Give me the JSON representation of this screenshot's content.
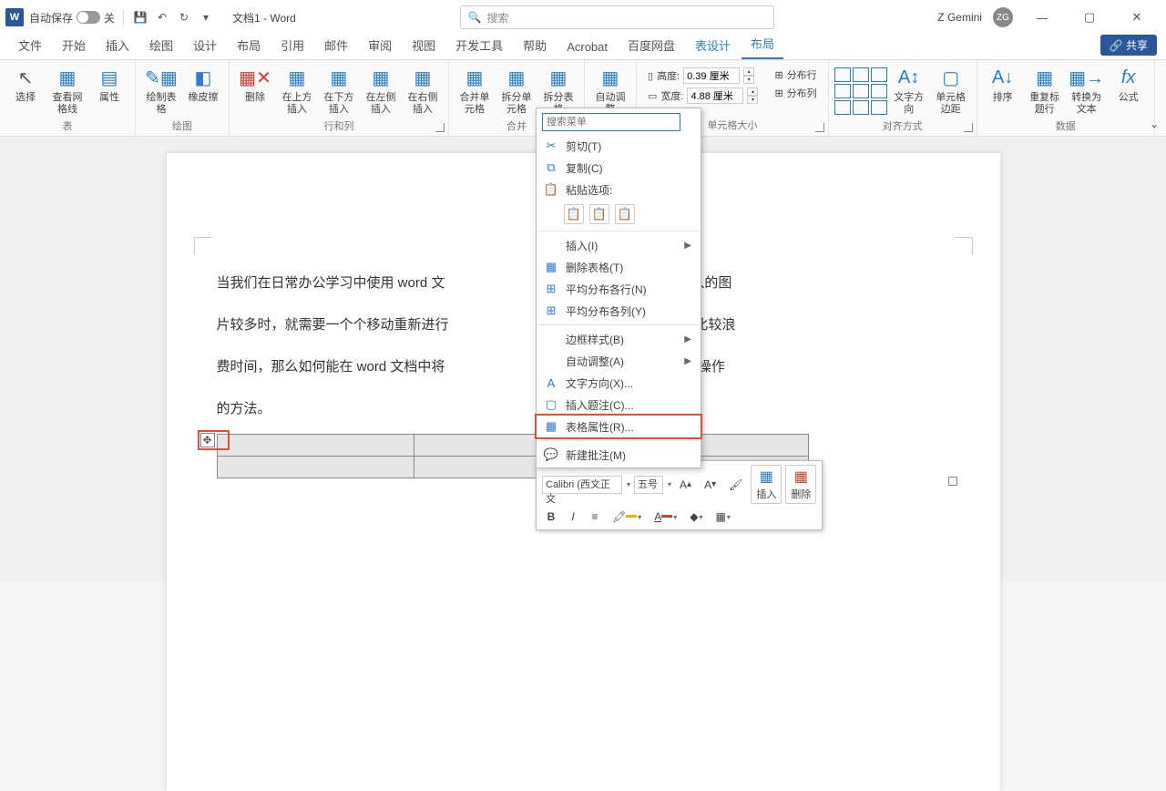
{
  "titlebar": {
    "autosave_label": "自动保存",
    "autosave_state": "关",
    "doc_title": "文档1 - Word",
    "search_placeholder": "搜索",
    "user_name": "Z Gemini",
    "user_initials": "ZG"
  },
  "tabs": [
    "文件",
    "开始",
    "插入",
    "绘图",
    "设计",
    "布局",
    "引用",
    "邮件",
    "审阅",
    "视图",
    "开发工具",
    "帮助",
    "Acrobat",
    "百度网盘",
    "表设计",
    "布局"
  ],
  "active_tab_index": 15,
  "context_tab_indices": [
    14,
    15
  ],
  "share_label": "共享",
  "ribbon": {
    "group_table": {
      "label": "表",
      "cmds": [
        "选择",
        "查看网格线",
        "属性"
      ]
    },
    "group_draw": {
      "label": "绘图",
      "cmds": [
        "绘制表格",
        "橡皮擦"
      ]
    },
    "group_rowscols": {
      "label": "行和列",
      "cmds": [
        "删除",
        "在上方插入",
        "在下方插入",
        "在左侧插入",
        "在右侧插入"
      ]
    },
    "group_merge": {
      "label": "合并",
      "cmds": [
        "合并单元格",
        "拆分单元格",
        "拆分表格"
      ]
    },
    "group_autofit": "自动调整",
    "group_cellsize": {
      "label": "单元格大小",
      "height_label": "高度:",
      "width_label": "宽度:",
      "height_value": "0.39 厘米",
      "width_value": "4.88 厘米",
      "dist_rows": "分布行",
      "dist_cols": "分布列"
    },
    "group_align": {
      "label": "对齐方式",
      "text_dir": "文字方向",
      "cell_margin": "单元格边距"
    },
    "group_data": {
      "label": "数据",
      "cmds": [
        "排序",
        "重复标题行",
        "转换为文本",
        "公式"
      ]
    }
  },
  "document": {
    "body_lines": [
      "当我们在日常办公学习中使用 word 文",
      "片较多时，就需要一个个移动重新进行",
      "费时间，那么如何能在 word 文档中将",
      "的方法。"
    ],
    "body_right": [
      "插入一些图片，当插入的图",
      "美观，但这样操作就比较浪",
      "下来就给大家介绍一下操作"
    ]
  },
  "context_menu": {
    "search_placeholder": "搜索菜单",
    "cut": "剪切(T)",
    "copy": "复制(C)",
    "paste_header": "粘贴选项:",
    "insert": "插入(I)",
    "delete_table": "删除表格(T)",
    "dist_rows": "平均分布各行(N)",
    "dist_cols": "平均分布各列(Y)",
    "border_style": "边框样式(B)",
    "autofit": "自动调整(A)",
    "text_dir": "文字方向(X)...",
    "insert_caption": "插入题注(C)...",
    "table_props": "表格属性(R)...",
    "new_comment": "新建批注(M)"
  },
  "mini_toolbar": {
    "font_name": "Calibri (西文正文",
    "font_size": "五号",
    "insert_label": "插入",
    "delete_label": "删除"
  }
}
